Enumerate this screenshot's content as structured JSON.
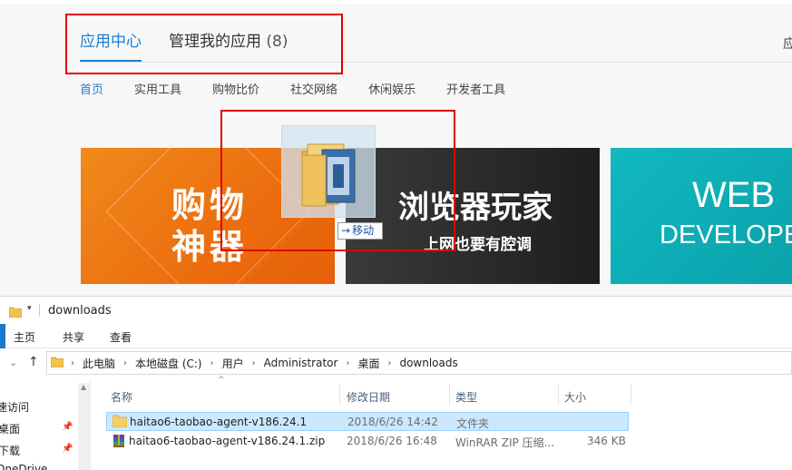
{
  "app": {
    "tabs": [
      {
        "label": "应用中心",
        "active": true
      },
      {
        "label": "管理我的应用",
        "count": "(8)",
        "active": false
      }
    ],
    "right_glyph": "应",
    "subnav": [
      "首页",
      "实用工具",
      "购物比价",
      "社交网络",
      "休闲娱乐",
      "开发者工具"
    ],
    "banners": {
      "shop": {
        "line1": "购物",
        "line2": "神器"
      },
      "browser": {
        "title": "浏览器玩家",
        "subtitle": "上网也要有腔调"
      },
      "web": {
        "line1": "WEB",
        "line2": "DEVELOPE"
      }
    },
    "drag_tooltip": "移动"
  },
  "explorer": {
    "title": "downloads",
    "ribbon_tabs": [
      "主页",
      "共享",
      "查看"
    ],
    "breadcrumb": [
      "此电脑",
      "本地磁盘 (C:)",
      "用户",
      "Administrator",
      "桌面",
      "downloads"
    ],
    "nav_items": [
      "速访问",
      "桌面",
      "下载",
      "OneDrive"
    ],
    "columns": [
      "名称",
      "修改日期",
      "类型",
      "大小"
    ],
    "files": [
      {
        "name": "haitao6-taobao-agent-v186.24.1",
        "date": "2018/6/26 14:42",
        "type": "文件夹",
        "size": "",
        "icon": "folder-icon",
        "selected": true
      },
      {
        "name": "haitao6-taobao-agent-v186.24.1.zip",
        "date": "2018/6/26 16:48",
        "type": "WinRAR ZIP 压缩...",
        "size": "346 KB",
        "icon": "winrar-archive-icon",
        "selected": false
      }
    ]
  },
  "colors": {
    "accent": "#1a7fd4",
    "highlight_box": "#e00000",
    "selection": "#cce8ff"
  }
}
